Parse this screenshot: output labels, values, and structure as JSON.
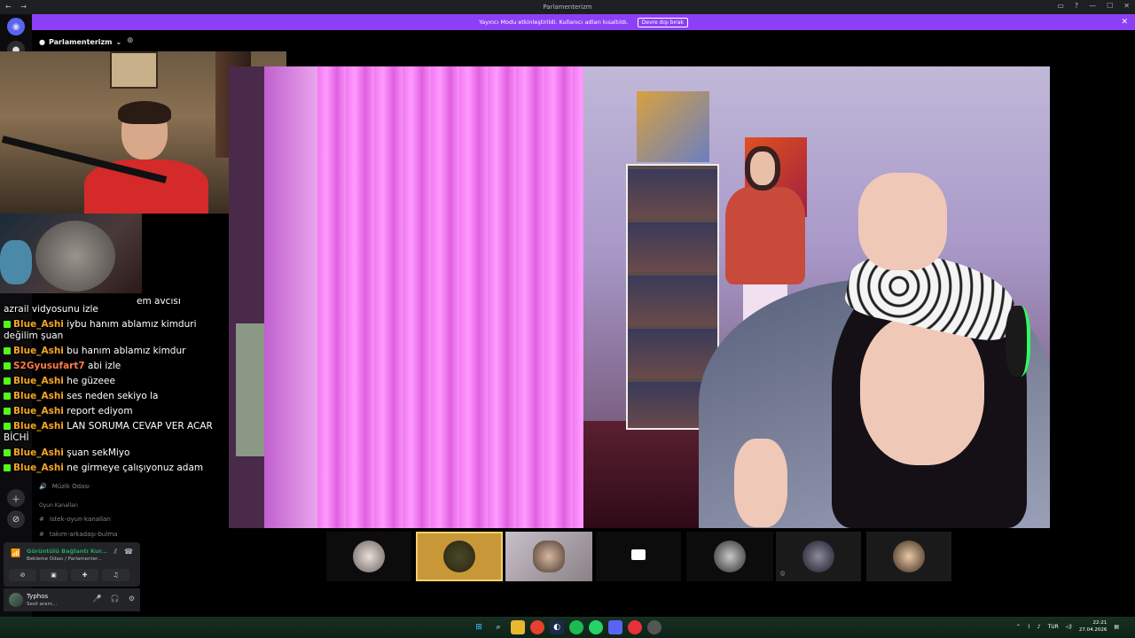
{
  "window": {
    "title": "Parlamenterizm",
    "nav": "← →",
    "controls": [
      "▭",
      "?",
      "—",
      "☐",
      "✕"
    ]
  },
  "banner": {
    "text": "Yayıncı Modu etkinleştirildi. Kullanıcı adları kısaltıldı.",
    "button": "Devre dışı bırak",
    "close": "✕"
  },
  "server": {
    "name": "Parlamenterizm"
  },
  "channels": [
    {
      "name": "Müzik Odası",
      "icon": "🔊"
    }
  ],
  "categories": [
    {
      "label": "Oyun Kanalları"
    }
  ],
  "text_channels": [
    {
      "name": "istek-oyun-kanalları"
    },
    {
      "name": "takım-arkadaşı-bulma"
    }
  ],
  "voice": {
    "title": "Görüntülü Bağlantı Kur...",
    "subtitle": "Bekleme Odası / Parlamenter..."
  },
  "user": {
    "name": "Typhos",
    "status": "Sesli aram..."
  },
  "chat": [
    {
      "user": "",
      "text": "em avcısı"
    },
    {
      "user": "",
      "text": "azrail vidyosunu izle"
    },
    {
      "user": "Blue_Ashi",
      "text": "iybu hanım ablamız kimduri değilim şuan"
    },
    {
      "user": "Blue_Ashi",
      "text": "bu hanım ablamız kimdur"
    },
    {
      "user": "S2Gyusufart7",
      "text": "abi izle"
    },
    {
      "user": "Blue_Ashi",
      "text": "he güzeee"
    },
    {
      "user": "Blue_Ashi",
      "text": "ses neden sekiyo la"
    },
    {
      "user": "Blue_Ashi",
      "text": "report ediyom"
    },
    {
      "user": "Blue_Ashi",
      "text": "LAN SORUMA CEVAP VER ACAR BİCHİ"
    },
    {
      "user": "Blue_Ashi",
      "text": "şuan sekMiyo"
    },
    {
      "user": "Blue_Ashi",
      "text": "ne girmeye çalışıyonuz adam"
    }
  ],
  "taskbar": {
    "lang": "TUR",
    "time": "22:21",
    "date": "27.04.2026"
  }
}
